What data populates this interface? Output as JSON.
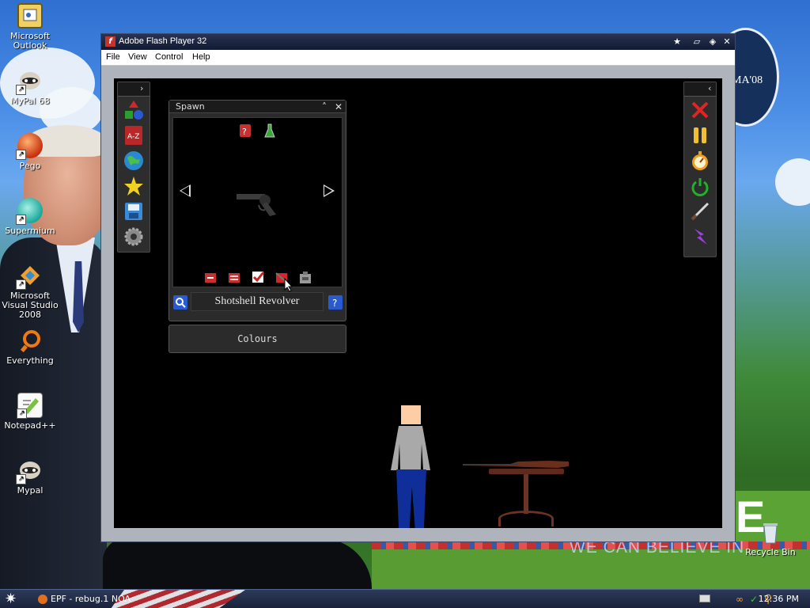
{
  "desktop": {
    "icons": [
      {
        "label": "Microsoft Outlook",
        "icon": "outlook-icon"
      },
      {
        "label": "MyPal 68",
        "icon": "mypal-icon"
      },
      {
        "label": "Pego",
        "icon": "pego-icon"
      },
      {
        "label": "Supermium",
        "icon": "supermium-icon"
      },
      {
        "label": "Microsoft Visual Studio 2008",
        "icon": "visual-studio-icon"
      },
      {
        "label": "Everything",
        "icon": "everything-icon"
      },
      {
        "label": "Notepad++",
        "icon": "notepadpp-icon"
      },
      {
        "label": "Mypal",
        "icon": "mypal-icon"
      }
    ],
    "recycle_bin": "Recycle Bin",
    "wallpaper_text": "WE CAN BELIEVE IN",
    "wallpaper_badge": "MA'08"
  },
  "window": {
    "title": "Adobe Flash Player 32",
    "menu": [
      "File",
      "View",
      "Control",
      "Help"
    ]
  },
  "game": {
    "spawn_panel": {
      "title": "Spawn",
      "item_name": "Shotshell Revolver"
    },
    "colours_button": "Colours",
    "left_tools": [
      "shapes-icon",
      "a-z-icon",
      "globe-icon",
      "star-icon",
      "save-icon",
      "settings-gear-icon"
    ],
    "right_tools": [
      "close-x-icon",
      "pause-icon",
      "stopwatch-icon",
      "power-icon",
      "knife-icon",
      "lightning-icon"
    ],
    "bottom_tools": [
      "remove-icon",
      "sliders-icon",
      "check-icon",
      "erase-icon",
      "mechanical-icon"
    ]
  },
  "taskbar": {
    "task_label": "EPF - rebug.1 NOA",
    "clock": "12:36 PM"
  },
  "colors": {
    "titlebar": "#111a33",
    "stage": "#000000",
    "panel": "#2b2b2b"
  }
}
